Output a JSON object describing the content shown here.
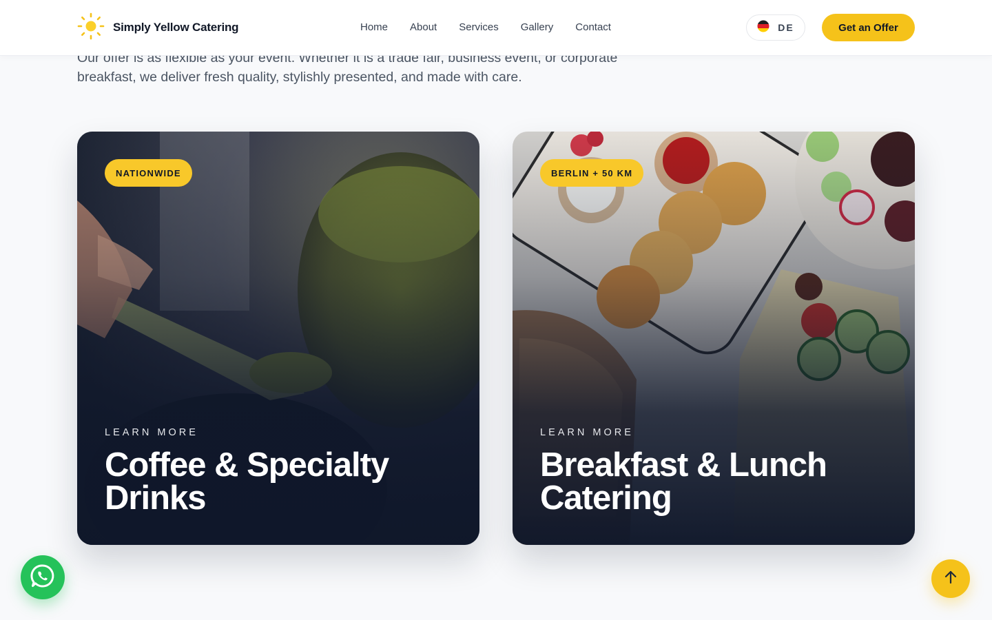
{
  "header": {
    "brand_name": "Simply Yellow Catering",
    "logo_icon": "sun-icon",
    "nav": [
      {
        "label": "Home"
      },
      {
        "label": "About"
      },
      {
        "label": "Services"
      },
      {
        "label": "Gallery"
      },
      {
        "label": "Contact"
      }
    ],
    "language": {
      "code": "DE",
      "flag_icon": "german-flag-icon"
    },
    "cta_label": "Get an Offer"
  },
  "intro": {
    "text": "Our offer is as flexible as your event. Whether it is a trade fair, business event, or corporate breakfast, we deliver fresh quality, stylishly presented, and made with care."
  },
  "cards": [
    {
      "badge": "NATIONWIDE",
      "kicker": "LEARN MORE",
      "title": "Coffee & Specialty Drinks",
      "image": "matcha-powder-jar-photo"
    },
    {
      "badge": "BERLIN + 50 KM",
      "kicker": "LEARN MORE",
      "title": "Breakfast & Lunch Catering",
      "image": "breakfast-platter-photo"
    }
  ],
  "floating": {
    "whatsapp_icon": "whatsapp-icon",
    "scroll_top_icon": "arrow-up-icon"
  },
  "colors": {
    "accent_yellow": "#f5c21a",
    "whatsapp_green": "#25c25a",
    "card_overlay_navy": "#0f172a"
  }
}
